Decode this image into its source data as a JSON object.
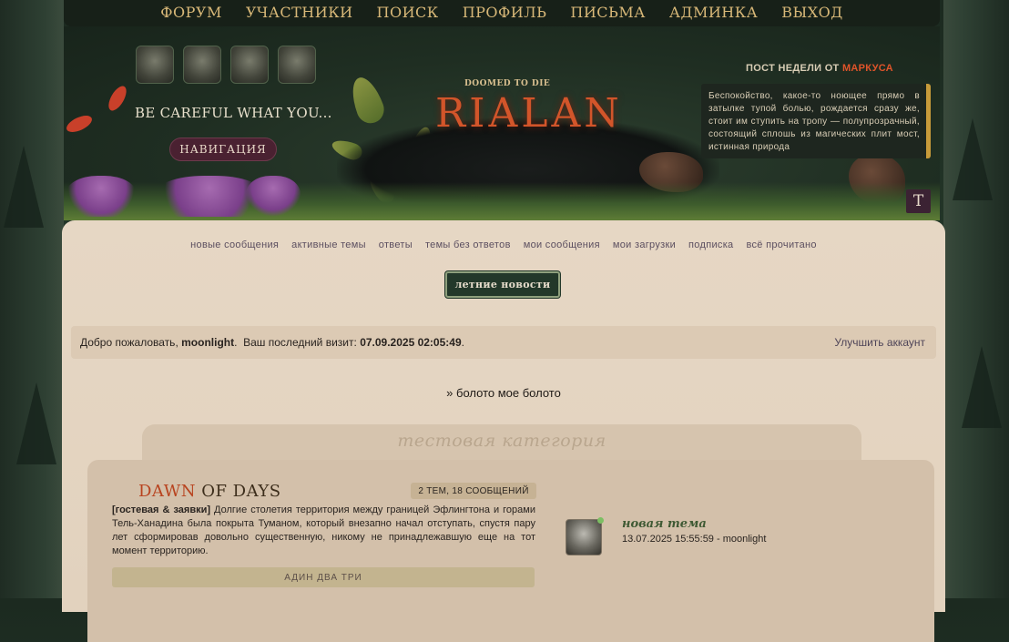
{
  "topnav": [
    "ФОРУМ",
    "УЧАСТНИКИ",
    "ПОИСК",
    "ПРОФИЛЬ",
    "ПИСЬМА",
    "АДМИНКА",
    "ВЫХОД"
  ],
  "banner": {
    "tagline": "BE CAREFUL WHAT YOU...",
    "nav_button": "НАВИГАЦИЯ",
    "logo_small": "DOOMED TO DIE",
    "logo": "RIALAN",
    "post_of_week_prefix": "ПОСТ НЕДЕЛИ ОТ",
    "post_of_week_author": "МАРКУСА",
    "post_of_week_text": "Беспокойство, какое-то ноющее прямо в затылке тупой болью, рождается сразу же, стоит им ступить на тропу — полупрозрачный, состоящий сплошь из магических плит мост, истинная природа",
    "style_button": "T"
  },
  "quicklinks": [
    "новые сообщения",
    "активные темы",
    "ответы",
    "темы без ответов",
    "мои сообщения",
    "мои загрузки",
    "подписка",
    "всё прочитано"
  ],
  "news_button": "летние новости",
  "welcome": {
    "greeting": "Добро пожаловать,",
    "username": "moonlight",
    "last_visit_label": "Ваш последний визит:",
    "last_visit": "07.09.2025 02:05:49",
    "upgrade": "Улучшить аккаунт"
  },
  "breadcrumb": "» болото мое болото",
  "category": "тестовая категория",
  "forum": {
    "name_part1": "DAWN ",
    "name_part2": "OF DAYS",
    "stats": "2 ТЕМ, 18 СООБЩЕНИЙ",
    "desc_tag": "[гостевая & заявки]",
    "desc": " Долгие столетия территория между границей Эфлингтона и горами Тель-Ханадина была покрыта Туманом, который внезапно начал отступать, спустя пару лет сформировав довольно существенную, никому не принадлежавшую еще на тот момент территорию.",
    "subforum": "АДИН ДВА ТРИ",
    "last_post_title": "новая тема",
    "last_post_meta": "13.07.2025 15:55:59 - moonlight"
  }
}
